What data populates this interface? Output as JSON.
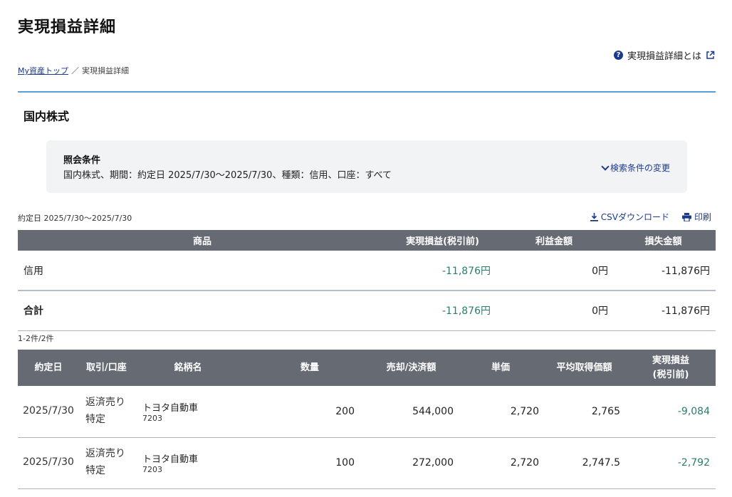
{
  "page_title": "実現損益詳細",
  "help_link": "実現損益詳細とは",
  "breadcrumb": {
    "home": "My資産トップ",
    "separator": "／",
    "current": "実現損益詳細"
  },
  "section_title": "国内株式",
  "conditions": {
    "label": "照会条件",
    "text": "国内株式、期間：約定日 2025/7/30〜2025/7/30、種類：信用、口座：すべて",
    "change_label": "検索条件の変更"
  },
  "period": "約定日 2025/7/30〜2025/7/30",
  "actions": {
    "csv": "CSVダウンロード",
    "print": "印刷"
  },
  "summary_table": {
    "headers": [
      "商品",
      "実現損益(税引前)",
      "利益金額",
      "損失金額"
    ],
    "rows": [
      {
        "product": "信用",
        "pl": "-11,876円",
        "profit": "0円",
        "loss": "-11,876円"
      },
      {
        "product": "合計",
        "pl": "-11,876円",
        "profit": "0円",
        "loss": "-11,876円"
      }
    ]
  },
  "count": "1-2件/2件",
  "detail_table": {
    "headers": [
      "約定日",
      "取引/口座",
      "銘柄名",
      "数量",
      "売却/決済額",
      "単価",
      "平均取得価額",
      "実現損益\n(税引前)"
    ],
    "rows": [
      {
        "date": "2025/7/30",
        "trade": "返済売り",
        "account": "特定",
        "name": "トヨタ自動車",
        "code": "7203",
        "qty": "200",
        "amount": "544,000",
        "price": "2,720",
        "avg": "2,765",
        "pl": "-9,084"
      },
      {
        "date": "2025/7/30",
        "trade": "返済売り",
        "account": "特定",
        "name": "トヨタ自動車",
        "code": "7203",
        "qty": "100",
        "amount": "272,000",
        "price": "2,720",
        "avg": "2,747.5",
        "pl": "-2,792"
      }
    ]
  },
  "colors": {
    "accent": "#1b3a8c",
    "header_bg": "#666a73",
    "positive_green": "#2a7d6e",
    "divider": "#5aa0d8"
  }
}
